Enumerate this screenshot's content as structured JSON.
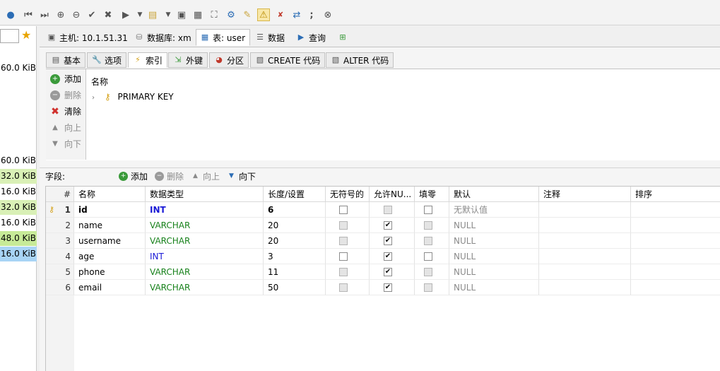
{
  "toolbar": {
    "icons": [
      "info-icon",
      "first-record-icon",
      "last-record-icon",
      "add-icon",
      "remove-icon",
      "check-icon",
      "cancel-icon",
      "run-icon",
      "dropdown-icon",
      "explorer-icon",
      "dropdown-icon",
      "save-icon",
      "save-all-icon",
      "binoculars-icon",
      "tree-icon",
      "edit-icon",
      "warning-icon",
      "delete-icon",
      "format-icon",
      "semicolon-icon",
      "stop-icon"
    ]
  },
  "left_panel": {
    "sizes": [
      {
        "label": "60.0 KiB",
        "color": ""
      },
      {
        "label": "60.0 KiB",
        "color": ""
      },
      {
        "label": "32.0 KiB",
        "color": "#d9f0b6"
      },
      {
        "label": "16.0 KiB",
        "color": ""
      },
      {
        "label": "32.0 KiB",
        "color": "#d9f0b6"
      },
      {
        "label": "16.0 KiB",
        "color": ""
      },
      {
        "label": "48.0 KiB",
        "color": "#c7ea98"
      },
      {
        "label": "16.0 KiB",
        "color": "#a8d4f5"
      }
    ]
  },
  "main_tabs": [
    {
      "label": "主机: 10.1.51.31",
      "icon": "host-icon"
    },
    {
      "label": "数据库: xm",
      "icon": "database-icon"
    },
    {
      "label": "表: user",
      "icon": "table-icon",
      "active": true
    },
    {
      "label": "数据",
      "icon": "data-grid-icon"
    },
    {
      "label": "查询",
      "icon": "query-run-icon"
    },
    {
      "label": "",
      "icon": "new-query-icon"
    }
  ],
  "sub_tabs": [
    {
      "label": "基本",
      "icon": "basic-icon"
    },
    {
      "label": "选项",
      "icon": "wrench-icon"
    },
    {
      "label": "索引",
      "icon": "lightning-icon",
      "active": true
    },
    {
      "label": "外键",
      "icon": "foreign-key-icon"
    },
    {
      "label": "分区",
      "icon": "partition-icon"
    },
    {
      "label": "CREATE 代码",
      "icon": "create-code-icon"
    },
    {
      "label": "ALTER 代码",
      "icon": "alter-code-icon"
    }
  ],
  "index_buttons": {
    "add": "添加",
    "delete": "删除",
    "clear": "清除",
    "up": "向上",
    "down": "向下"
  },
  "index_list": {
    "header": "名称",
    "items": [
      {
        "label": "PRIMARY KEY"
      }
    ]
  },
  "field_bar": {
    "label": "字段:",
    "add": "添加",
    "delete": "删除",
    "up": "向上",
    "down": "向下"
  },
  "grid": {
    "columns": [
      "#",
      "名称",
      "数据类型",
      "长度/设置",
      "无符号的",
      "允许NU...",
      "填零",
      "默认",
      "注释",
      "排序"
    ],
    "rows": [
      {
        "num": "1",
        "name": "id",
        "type": "INT",
        "length": "6",
        "unsigned": "unchecked",
        "nullable": "disabled",
        "zerofill": "unchecked",
        "default": "无默认值",
        "comment": "",
        "primary": true
      },
      {
        "num": "2",
        "name": "name",
        "type": "VARCHAR",
        "length": "20",
        "unsigned": "disabled",
        "nullable": "checked",
        "zerofill": "disabled",
        "default": "NULL",
        "comment": ""
      },
      {
        "num": "3",
        "name": "username",
        "type": "VARCHAR",
        "length": "20",
        "unsigned": "disabled",
        "nullable": "checked",
        "zerofill": "disabled",
        "default": "NULL",
        "comment": ""
      },
      {
        "num": "4",
        "name": "age",
        "type": "INT",
        "length": "3",
        "unsigned": "unchecked",
        "nullable": "checked",
        "zerofill": "unchecked",
        "default": "NULL",
        "comment": ""
      },
      {
        "num": "5",
        "name": "phone",
        "type": "VARCHAR",
        "length": "11",
        "unsigned": "disabled",
        "nullable": "checked",
        "zerofill": "disabled",
        "default": "NULL",
        "comment": ""
      },
      {
        "num": "6",
        "name": "email",
        "type": "VARCHAR",
        "length": "50",
        "unsigned": "disabled",
        "nullable": "checked",
        "zerofill": "disabled",
        "default": "NULL",
        "comment": ""
      }
    ]
  },
  "colors": {
    "int": "#1a1ad6",
    "varchar": "#18821c",
    "default": "#8a8a8a",
    "key": "#d4a017"
  }
}
